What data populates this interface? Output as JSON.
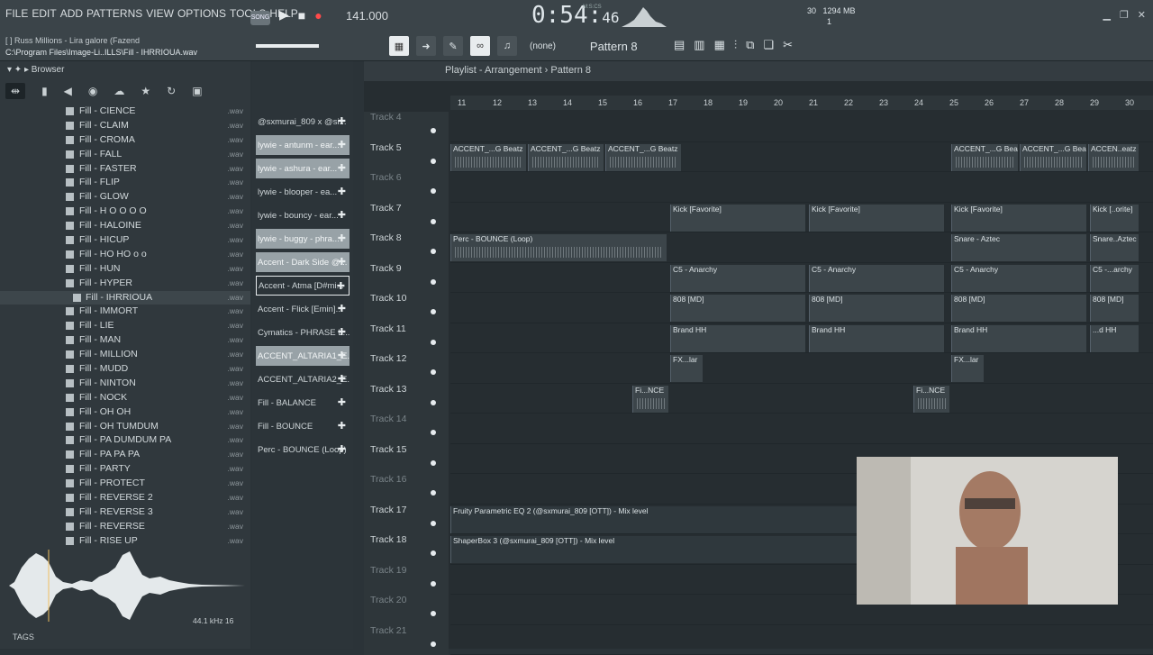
{
  "menu": [
    "FILE",
    "EDIT",
    "ADD",
    "PATTERNS",
    "VIEW",
    "OPTIONS",
    "TOOLS",
    "HELP"
  ],
  "song_mode": "SONG",
  "bpm": "141.000",
  "time": {
    "main": "0:54:",
    "sub": "46",
    "label": "M:S:CS"
  },
  "cpu": {
    "voices": "30",
    "mem": "1294 MB",
    "cores": "1"
  },
  "hint": {
    "line1": "[ ] Russ Millions - Lira galore (Fazend",
    "line2": "C:\\Program Files\\Image-Li..ILLS\\Fill - IHRRIOUA.wav"
  },
  "snap": "(none)",
  "pattern": "Pattern 8",
  "browser": {
    "title": "Browser"
  },
  "files": [
    "Fill - CIENCE",
    "Fill - CLAIM",
    "Fill - CROMA",
    "Fill - FALL",
    "Fill - FASTER",
    "Fill - FLIP",
    "Fill - GLOW",
    "Fill - H O O O O",
    "Fill - HALOINE",
    "Fill - HICUP",
    "Fill - HO HO o o",
    "Fill - HUN",
    "Fill - HYPER",
    "Fill - IHRRIOUA",
    "Fill - IMMORT",
    "Fill - LIE",
    "Fill - MAN",
    "Fill - MILLION",
    "Fill - MUDD",
    "Fill - NINTON",
    "Fill - NOCK",
    "Fill - OH OH",
    "Fill - OH TUMDUM",
    "Fill - PA DUMDUM PA",
    "Fill - PA PA PA",
    "Fill - PARTY",
    "Fill - PROTECT",
    "Fill - REVERSE 2",
    "Fill - REVERSE 3",
    "Fill - REVERSE",
    "Fill - RISE UP"
  ],
  "file_ext": ".wav",
  "wave_meta": "44.1 kHz 16",
  "tags_label": "TAGS",
  "channels": [
    "@sxmurai_809 x @si...",
    "lywie - antunm - ear...",
    "lywie - ashura - ear...",
    "lywie - blooper - ea...",
    "lywie - bouncy - ear...",
    "lywie - buggy - phra...",
    "Accent - Dark Side @...",
    "Accent - Atma [D#mi...",
    "Accent - Flick [Emin]...",
    "Cymatics - PHRASE L...",
    "ACCENT_ALTARIA1_E...",
    "ACCENT_ALTARIA2_E...",
    "Fill - BALANCE",
    "Fill - BOUNCE",
    "Perc - BOUNCE (Loop)"
  ],
  "playlist_title": "Playlist - Arrangement › Pattern 8",
  "ruler": [
    "11",
    "12",
    "13",
    "14",
    "15",
    "16",
    "17",
    "18",
    "19",
    "20",
    "21",
    "22",
    "23",
    "24",
    "25",
    "26",
    "27",
    "28",
    "29",
    "30"
  ],
  "tracks": [
    "Track 4",
    "Track 5",
    "Track 6",
    "Track 7",
    "Track 8",
    "Track 9",
    "Track 10",
    "Track 11",
    "Track 12",
    "Track 13",
    "Track 14",
    "Track 15",
    "Track 16",
    "Track 17",
    "Track 18",
    "Track 19",
    "Track 20",
    "Track 21"
  ],
  "clips": {
    "accent": "ACCENT_...G Beatz",
    "accent_end": "ACCEN..eatz",
    "kick": "Kick [Favorite]",
    "kick_end": "Kick [..orite]",
    "perc": "Perc - BOUNCE (Loop)",
    "snare": "Snare - Aztec",
    "snare_end": "Snare..Aztec",
    "c5": "C5 - Anarchy",
    "c5_end": "C5 -...archy",
    "b808": "808 [MD]",
    "hh": "Brand HH",
    "hh_end": "...d HH",
    "fx": "FX...lar",
    "fi": "Fi...NCE",
    "eq": "Fruity Parametric EQ 2 (@sxmurai_809 [OTT]) - Mix level",
    "shaper": "ShaperBox 3 (@sxmurai_809 [OTT]) - Mix level"
  }
}
